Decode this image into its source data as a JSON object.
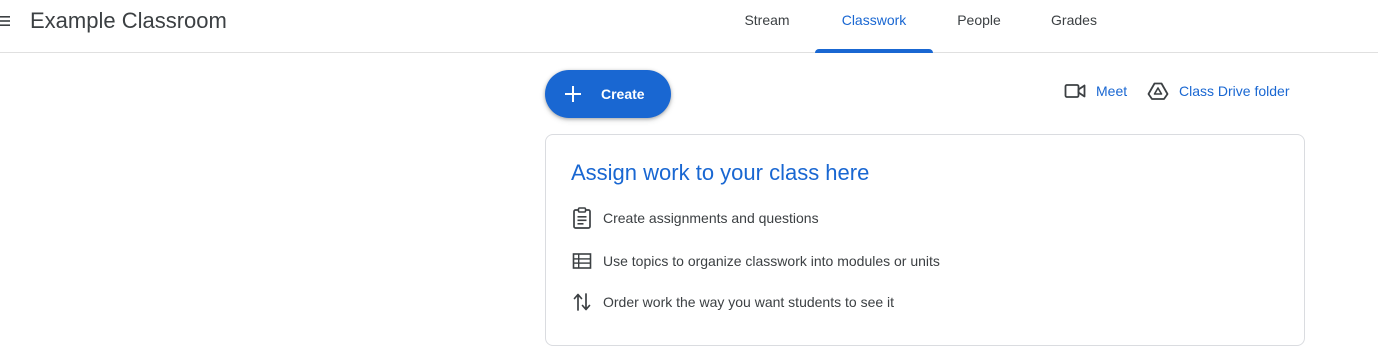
{
  "header": {
    "menu_icon": "hamburger-menu-icon",
    "class_title": "Example Classroom",
    "tabs": [
      {
        "label": "Stream",
        "active": false
      },
      {
        "label": "Classwork",
        "active": true
      },
      {
        "label": "People",
        "active": false
      },
      {
        "label": "Grades",
        "active": false
      }
    ]
  },
  "toolbar": {
    "create_label": "Create",
    "create_icon": "plus-icon",
    "meet_label": "Meet",
    "meet_icon": "video-camera-icon",
    "drive_label": "Class Drive folder",
    "drive_icon": "drive-icon"
  },
  "card": {
    "title": "Assign work to your class here",
    "tips": [
      {
        "icon": "clipboard-icon",
        "text": "Create assignments and questions"
      },
      {
        "icon": "topic-list-icon",
        "text": "Use topics to organize classwork into modules or units"
      },
      {
        "icon": "reorder-arrows-icon",
        "text": "Order work the way you want students to see it"
      }
    ]
  },
  "colors": {
    "accent": "#1967d2",
    "text": "#3c4043",
    "border": "#dadce0"
  }
}
